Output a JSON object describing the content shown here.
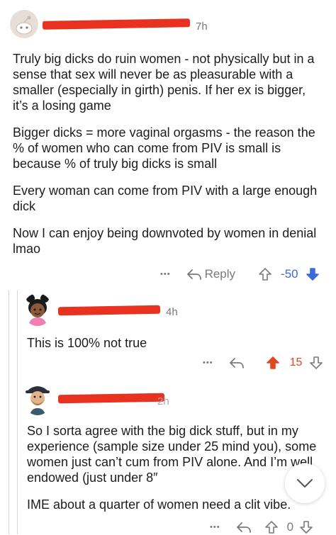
{
  "comments": [
    {
      "time": "7h",
      "paragraphs": [
        "Truly big dicks do ruin women - not physically but in a sense that sex will never be as pleasurable with a smaller (especially in girth) penis. If her ex is bigger, it’s a losing game",
        "Bigger dicks = more vaginal orgasms - the reason the % of women who can come from PIV is small is because % of truly big dicks is small",
        "Every woman can come from PIV with a large enough dick",
        "Now I can enjoy being downvoted by women in denial lmao"
      ],
      "more_label": "•••",
      "reply_label": "Reply",
      "score": "-50",
      "vote_state": "downvoted"
    },
    {
      "time": "4h",
      "paragraphs": [
        "This is 100% not true"
      ],
      "more_label": "•••",
      "score": "15",
      "vote_state": "upvoted"
    },
    {
      "time": "2h",
      "paragraphs": [
        "So I sorta agree with the big dick stuff, but in my experience (sample size under 25 mind you), some women just can’t cum from PIV alone. And I’m well endowed (just under 8″",
        "IME about a quarter of women need a clit vibe."
      ],
      "more_label": "•••",
      "score": "0",
      "vote_state": "none"
    }
  ],
  "colors": {
    "redaction": "#e8321f",
    "downvote": "#3a6bd6",
    "upvote": "#e0491f"
  }
}
